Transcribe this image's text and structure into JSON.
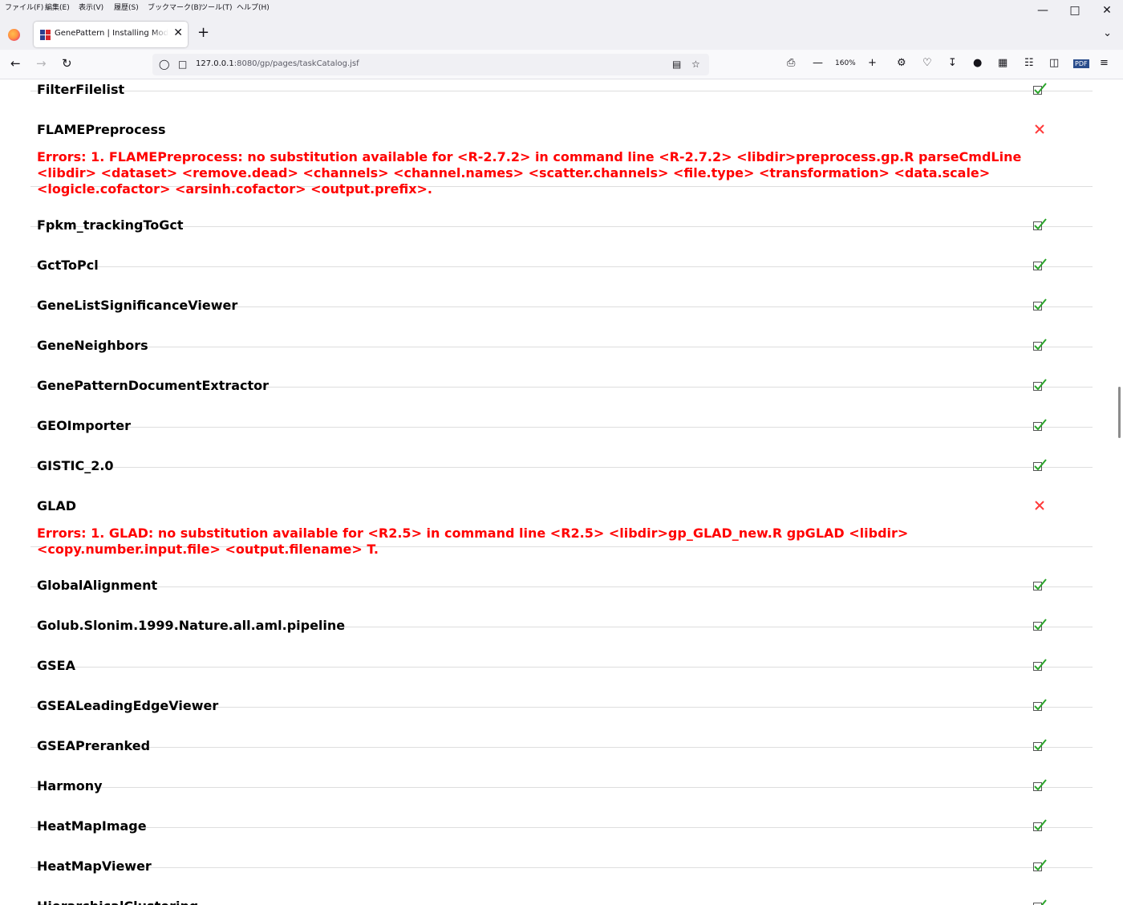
{
  "menubar": {
    "items": [
      "ファイル(F)",
      "編集(E)",
      "表示(V)",
      "履歴(S)",
      "ブックマーク(B)",
      "ツール(T)",
      "ヘルプ(H)"
    ]
  },
  "window_controls": {
    "minimize": "—",
    "maximize": "□",
    "close": "✕"
  },
  "tab": {
    "title": "GenePattern | Installing Modules",
    "close": "✕"
  },
  "newtab": "+",
  "url": {
    "host": "127.0.0.1",
    "path": ":8080/gp/pages/taskCatalog.jsf"
  },
  "zoom": "160%",
  "modules": [
    {
      "name": "FilterFilelist",
      "status": "ok"
    },
    {
      "name": "FLAMEPreprocess",
      "status": "error",
      "error": "Errors: 1. FLAMEPreprocess: no substitution available for <R-2.7.2> in command line <R-2.7.2> <libdir>preprocess.gp.R parseCmdLine <libdir> <dataset> <remove.dead> <channels> <channel.names> <scatter.channels> <file.type> <transformation> <data.scale> <logicle.cofactor> <arsinh.cofactor> <output.prefix>."
    },
    {
      "name": "Fpkm_trackingToGct",
      "status": "ok"
    },
    {
      "name": "GctToPcl",
      "status": "ok"
    },
    {
      "name": "GeneListSignificanceViewer",
      "status": "ok"
    },
    {
      "name": "GeneNeighbors",
      "status": "ok"
    },
    {
      "name": "GenePatternDocumentExtractor",
      "status": "ok"
    },
    {
      "name": "GEOImporter",
      "status": "ok"
    },
    {
      "name": "GISTIC_2.0",
      "status": "ok"
    },
    {
      "name": "GLAD",
      "status": "error",
      "error": "Errors: 1. GLAD: no substitution available for <R2.5> in command line <R2.5> <libdir>gp_GLAD_new.R gpGLAD <libdir> <copy.number.input.file> <output.filename> T."
    },
    {
      "name": "GlobalAlignment",
      "status": "ok"
    },
    {
      "name": "Golub.Slonim.1999.Nature.all.aml.pipeline",
      "status": "ok"
    },
    {
      "name": "GSEA",
      "status": "ok"
    },
    {
      "name": "GSEALeadingEdgeViewer",
      "status": "ok"
    },
    {
      "name": "GSEAPreranked",
      "status": "ok"
    },
    {
      "name": "Harmony",
      "status": "ok"
    },
    {
      "name": "HeatMapImage",
      "status": "ok"
    },
    {
      "name": "HeatMapViewer",
      "status": "ok"
    },
    {
      "name": "HierarchicalClustering",
      "status": "ok"
    }
  ],
  "colors": {
    "error": "#ff0000",
    "ok_check": "#2aa52a",
    "fail_x": "#ff3b3b"
  }
}
